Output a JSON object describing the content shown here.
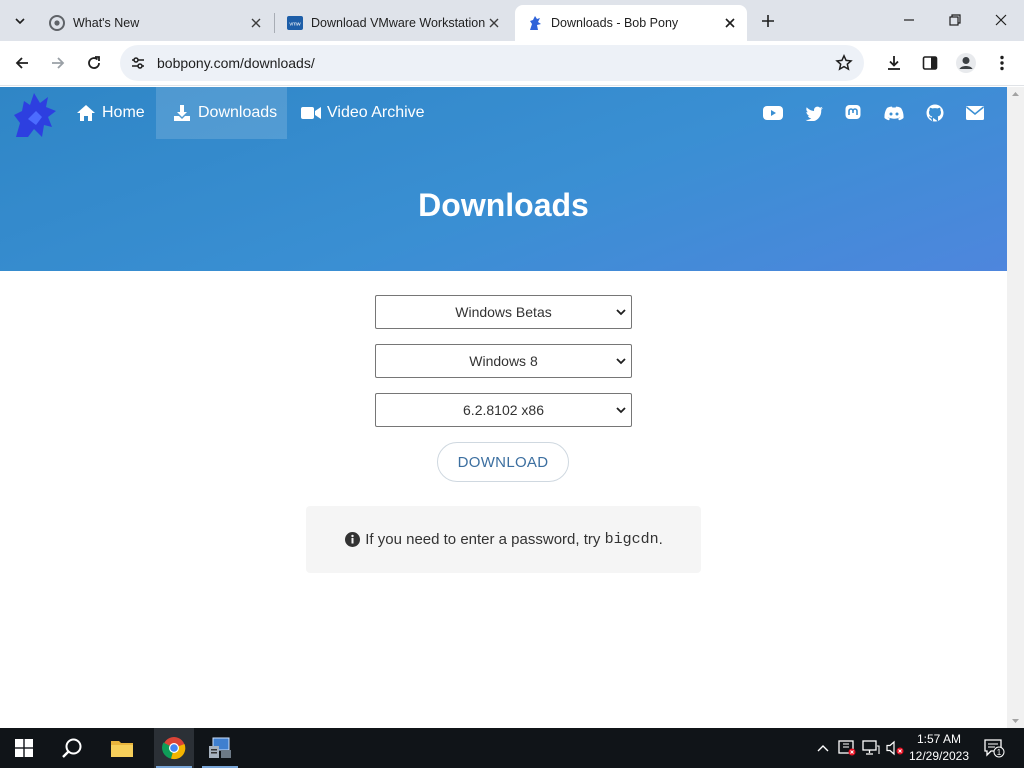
{
  "browser": {
    "tabs": [
      {
        "title": "What's New",
        "active": false
      },
      {
        "title": "Download VMware Workstation",
        "active": false
      },
      {
        "title": "Downloads - Bob Pony",
        "active": true
      }
    ],
    "address": "bobpony.com/downloads/"
  },
  "site": {
    "nav": [
      {
        "label": "Home",
        "icon": "home-icon"
      },
      {
        "label": "Downloads",
        "icon": "download-icon"
      },
      {
        "label": "Video Archive",
        "icon": "video-icon"
      }
    ],
    "social_icons": [
      "youtube-icon",
      "twitter-icon",
      "mastodon-icon",
      "discord-icon",
      "github-icon",
      "email-icon"
    ],
    "hero_title": "Downloads",
    "accent_color": "#3a8fd3"
  },
  "downloads": {
    "category": "Windows Betas",
    "product": "Windows 8",
    "build": "6.2.8102 x86",
    "button_label": "DOWNLOAD",
    "notice_text": "If you need to enter a password, try ",
    "notice_code": "bigcdn",
    "notice_end": "."
  },
  "taskbar": {
    "time": "1:57 AM",
    "date": "12/29/2023",
    "notification_count": "1"
  }
}
